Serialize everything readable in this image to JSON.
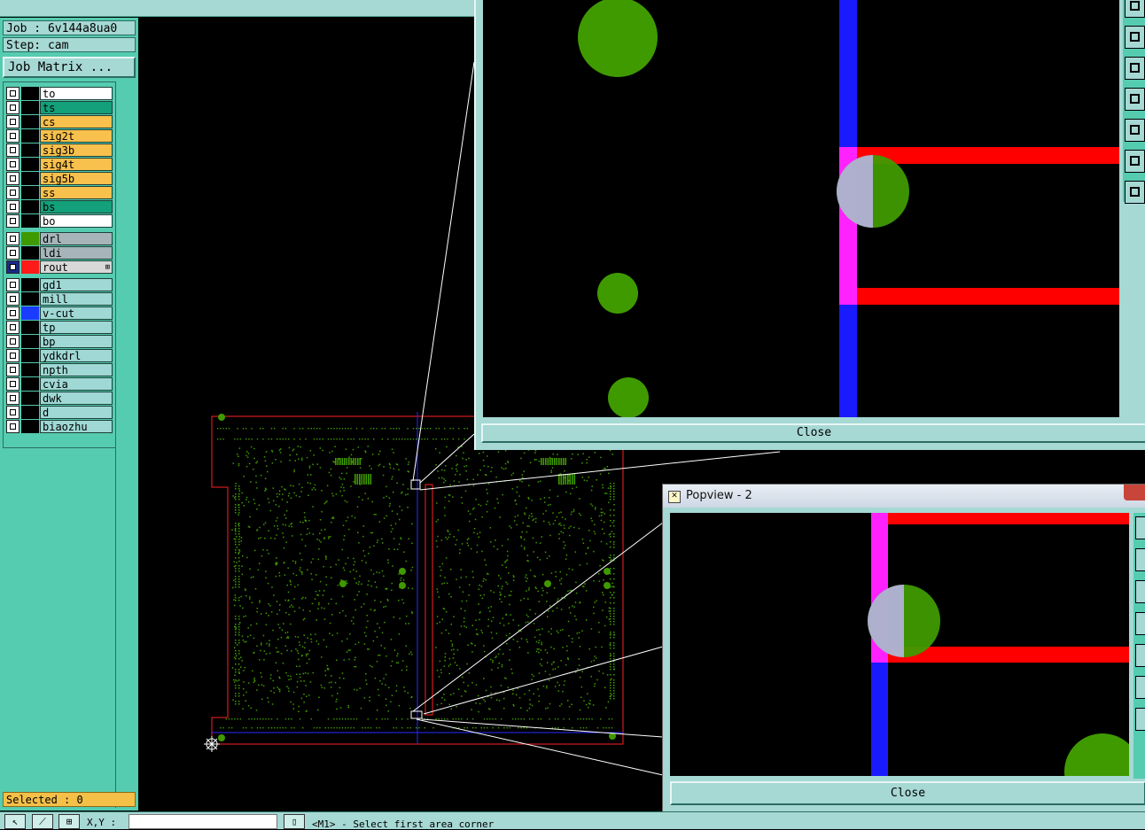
{
  "header": {
    "job_label": "Job : 6v144a8ua0",
    "step_label": "Step: cam",
    "job_matrix_button": "Job Matrix ..."
  },
  "layers": [
    {
      "name": "to",
      "color": "#ffffff",
      "swatch": "#000000",
      "checked_style": "normal"
    },
    {
      "name": "ts",
      "color": "#13a07a",
      "swatch": "#000000",
      "checked_style": "normal"
    },
    {
      "name": "cs",
      "color": "#f8c04c",
      "swatch": "#000000",
      "checked_style": "normal"
    },
    {
      "name": "sig2t",
      "color": "#f8c04c",
      "swatch": "#000000",
      "checked_style": "normal"
    },
    {
      "name": "sig3b",
      "color": "#f8c04c",
      "swatch": "#000000",
      "checked_style": "normal"
    },
    {
      "name": "sig4t",
      "color": "#f8c04c",
      "swatch": "#000000",
      "checked_style": "normal"
    },
    {
      "name": "sig5b",
      "color": "#f8c04c",
      "swatch": "#000000",
      "checked_style": "normal"
    },
    {
      "name": "ss",
      "color": "#f8c04c",
      "swatch": "#000000",
      "checked_style": "normal"
    },
    {
      "name": "bs",
      "color": "#13a07a",
      "swatch": "#000000",
      "checked_style": "normal"
    },
    {
      "name": "bo",
      "color": "#ffffff",
      "swatch": "#000000",
      "checked_style": "normal"
    },
    {
      "name": "drl",
      "color": "#a7b5bb",
      "swatch": "#3f9a00",
      "checked_style": "normal"
    },
    {
      "name": "ldi",
      "color": "#a7b5bb",
      "swatch": "#000000",
      "checked_style": "normal"
    },
    {
      "name": "rout",
      "color": "#d8d8d8",
      "swatch": "#ff1a1a",
      "checked_style": "dark",
      "indicator": "⊞"
    },
    {
      "name": "gd1",
      "color": "#9fd8d4",
      "swatch": "#000000",
      "checked_style": "normal"
    },
    {
      "name": "mill",
      "color": "#9fd8d4",
      "swatch": "#000000",
      "checked_style": "normal"
    },
    {
      "name": "v-cut",
      "color": "#9fd8d4",
      "swatch": "#1a3cff",
      "checked_style": "normal"
    },
    {
      "name": "tp",
      "color": "#9fd8d4",
      "swatch": "#000000",
      "checked_style": "normal"
    },
    {
      "name": "bp",
      "color": "#9fd8d4",
      "swatch": "#000000",
      "checked_style": "normal"
    },
    {
      "name": "ydkdrl",
      "color": "#9fd8d4",
      "swatch": "#000000",
      "checked_style": "normal"
    },
    {
      "name": "npth",
      "color": "#9fd8d4",
      "swatch": "#000000",
      "checked_style": "normal"
    },
    {
      "name": "cvia",
      "color": "#9fd8d4",
      "swatch": "#000000",
      "checked_style": "normal"
    },
    {
      "name": "dwk",
      "color": "#9fd8d4",
      "swatch": "#000000",
      "checked_style": "normal"
    },
    {
      "name": "d",
      "color": "#9fd8d4",
      "swatch": "#000000",
      "checked_style": "normal"
    },
    {
      "name": "biaozhu",
      "color": "#9fd8d4",
      "swatch": "#000000",
      "checked_style": "normal"
    }
  ],
  "selection": {
    "label": "Selected : 0"
  },
  "status_bar": {
    "xy_label": "X,Y :",
    "xy_value": "",
    "message": "<M1> - Select first area corner"
  },
  "popview1": {
    "close_label": "Close"
  },
  "popview2": {
    "title": "Popview - 2",
    "close_label": "Close"
  },
  "colors": {
    "drill": "#3f9a00",
    "rout": "#ff0000",
    "vcut": "#1a1aff",
    "overlap": "#ff22ff",
    "panel_bg": "#55ccb0",
    "light_bg": "#a6d8d4"
  },
  "icons": {
    "origin": "origin-crosshair-icon",
    "pointer_tool": "arrow-pointer-icon",
    "zoom_tool": "zoom-icon"
  }
}
